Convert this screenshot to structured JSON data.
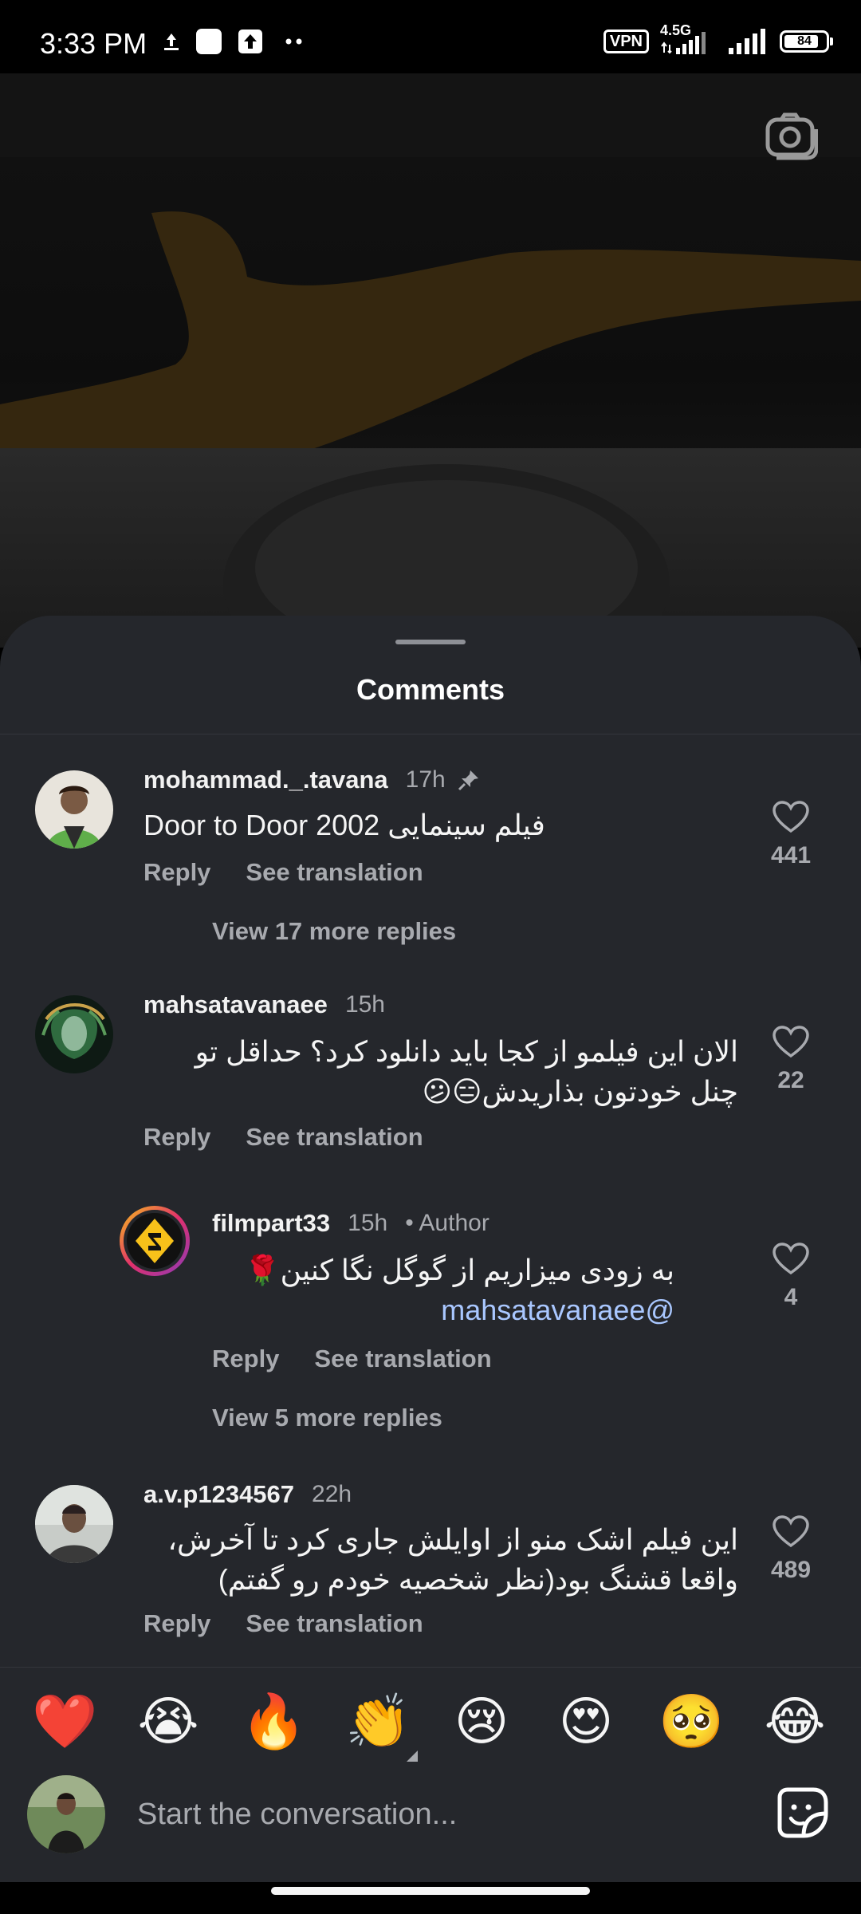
{
  "status_bar": {
    "time": "3:33 PM",
    "vpn": "VPN",
    "network": "4.5G",
    "battery": "84",
    "battery_level": 0.84
  },
  "sheet": {
    "title": "Comments"
  },
  "comments": [
    {
      "username": "mohammad._.tavana",
      "time": "17h",
      "pinned": true,
      "text": "Door to Door 2002 فیلم سینمایی",
      "reply_label": "Reply",
      "translate_label": "See translation",
      "likes": "441",
      "view_more": "View 17 more replies"
    },
    {
      "username": "mahsatavanaee",
      "time": "15h",
      "text": "الان این فیلمو از کجا باید دانلود کرد؟ حداقل تو چنل خودتون بذاریدش😑😕",
      "reply_label": "Reply",
      "translate_label": "See translation",
      "likes": "22"
    },
    {
      "username": "filmpart33",
      "time": "15h",
      "author_tag": "Author",
      "mention": "@mahsatavanaee",
      "text": "به زودی میزاریم از گوگل نگا کنین🌹",
      "reply_label": "Reply",
      "translate_label": "See translation",
      "likes": "4",
      "view_more": "View 5 more replies"
    },
    {
      "username": "a.v.p1234567",
      "time": "22h",
      "text": "این فیلم اشک منو از اوایلش جاری کرد تا آخرش، واقعا قشنگ بود(نظر شخصیه خودم رو گفتم)",
      "reply_label": "Reply",
      "translate_label": "See translation",
      "likes": "489"
    }
  ],
  "reactions": [
    "❤️",
    "😭",
    "🔥",
    "👏",
    "😢",
    "😍",
    "🥺",
    "😂"
  ],
  "composer": {
    "placeholder": "Start the conversation..."
  },
  "icons": {
    "camera": "camera-icon",
    "pin": "pin-icon",
    "heart": "heart-outline-icon",
    "sticker": "sticker-icon"
  },
  "colors": {
    "sheet_bg": "#25272c",
    "secondary_text": "#a8aaaf",
    "mention": "#a9c7ff"
  }
}
